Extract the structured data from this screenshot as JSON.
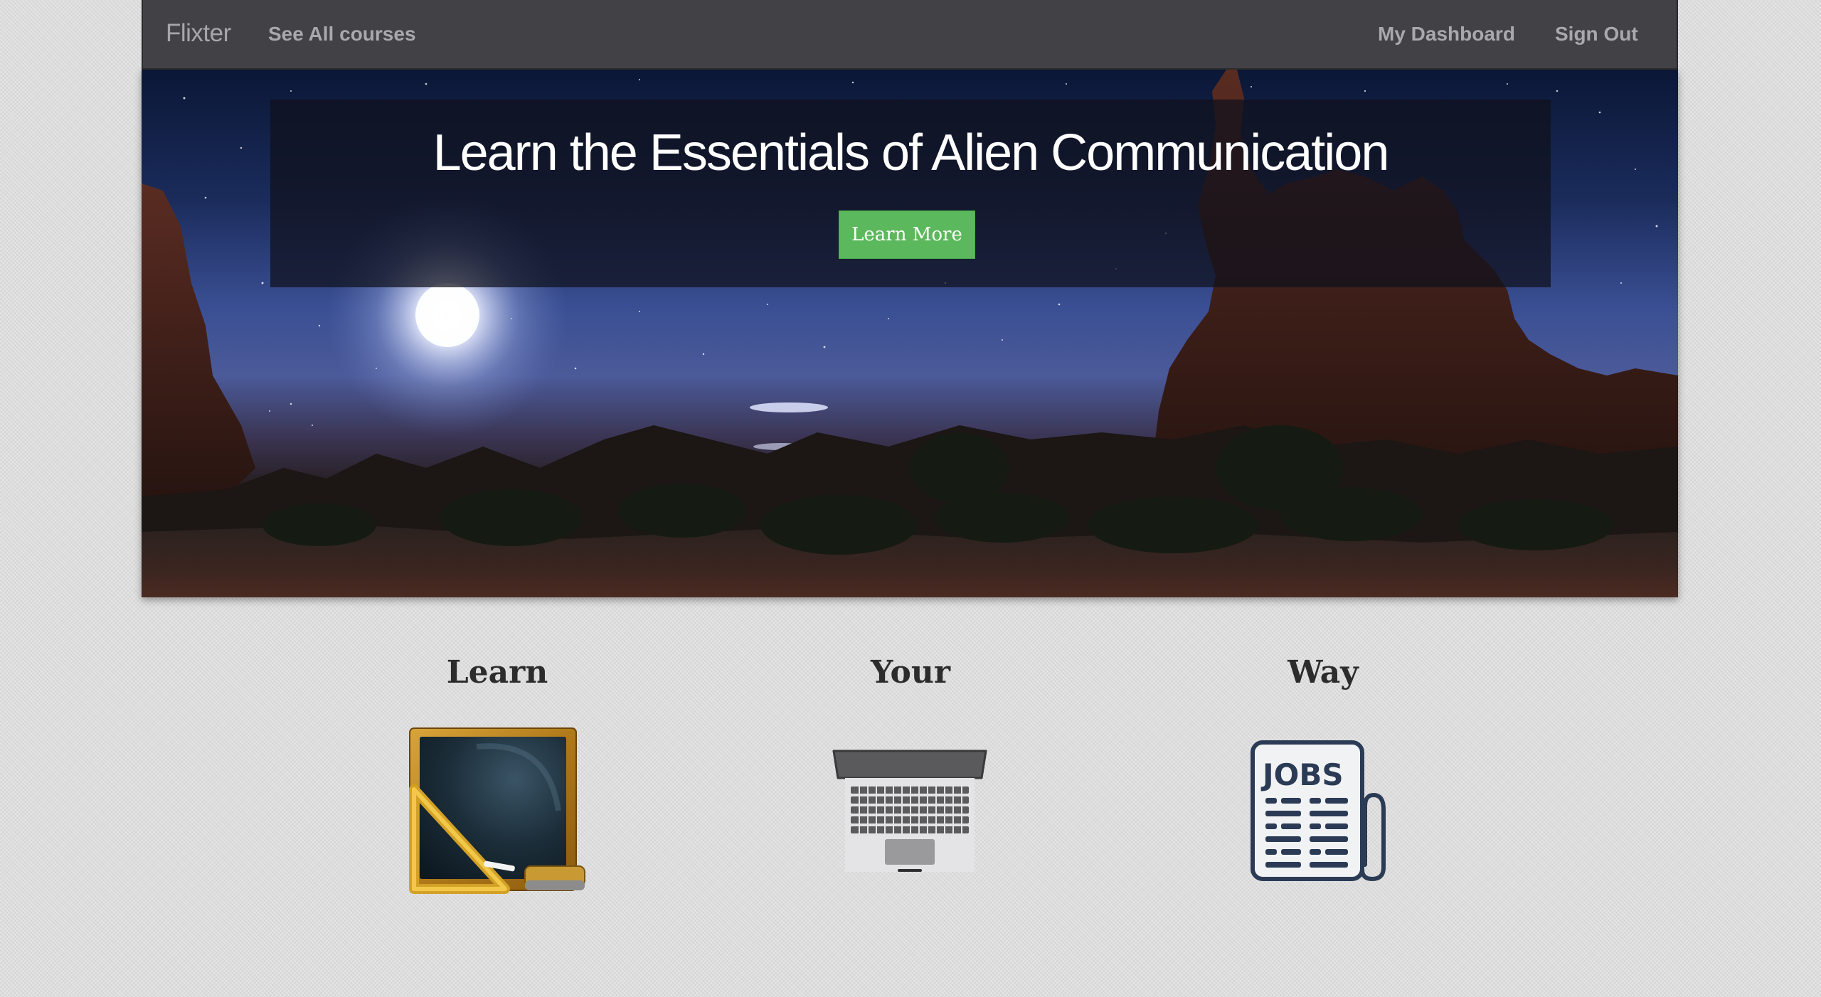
{
  "navbar": {
    "brand": "Flixter",
    "links_left": [
      {
        "label": "See All courses"
      }
    ],
    "links_right": [
      {
        "label": "My Dashboard"
      },
      {
        "label": "Sign Out"
      }
    ]
  },
  "hero": {
    "title": "Learn the Essentials of Alien Communication",
    "button_label": "Learn More",
    "button_color": "#5cb85c"
  },
  "features": [
    {
      "title": "Learn",
      "icon": "chalkboard-icon"
    },
    {
      "title": "Your",
      "icon": "laptop-icon"
    },
    {
      "title": "Way",
      "icon": "jobs-newspaper-icon"
    }
  ]
}
